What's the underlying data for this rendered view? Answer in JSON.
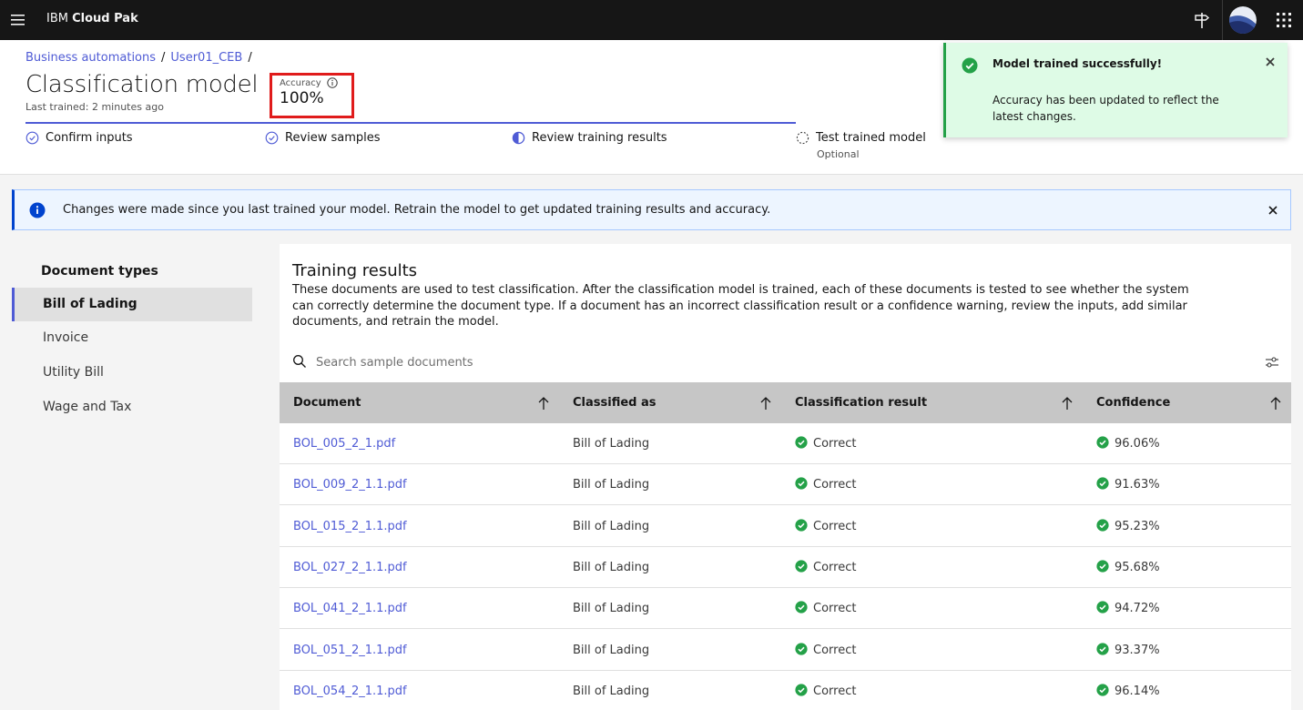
{
  "topbar": {
    "brand_prefix": "IBM",
    "brand_name": "Cloud Pak",
    "menu_icon": "hamburger-menu-icon",
    "signpost_icon": "signpost-icon",
    "apps_icon": "app-switcher-icon"
  },
  "breadcrumb": {
    "items": [
      "Business automations",
      "User01_CEB"
    ],
    "separator": "/"
  },
  "header": {
    "title": "Classification model",
    "last_trained": "Last trained: 2 minutes ago",
    "accuracy_label": "Accuracy",
    "accuracy_value": "100%"
  },
  "steps": [
    {
      "label": "Confirm inputs",
      "status": "complete"
    },
    {
      "label": "Review samples",
      "status": "complete"
    },
    {
      "label": "Review training results",
      "status": "current"
    },
    {
      "label": "Test trained model",
      "status": "incomplete",
      "sublabel": "Optional"
    }
  ],
  "toast": {
    "title": "Model trained successfully!",
    "body": "Accuracy has been updated to reflect the latest changes."
  },
  "banner": {
    "text": "Changes were made since you last trained your model. Retrain the model to get updated training results and accuracy."
  },
  "sidebar": {
    "heading": "Document types",
    "items": [
      {
        "label": "Bill of Lading",
        "active": true
      },
      {
        "label": "Invoice",
        "active": false
      },
      {
        "label": "Utility Bill",
        "active": false
      },
      {
        "label": "Wage and Tax",
        "active": false
      }
    ]
  },
  "main": {
    "title": "Training results",
    "description": "These documents are used to test classification. After the classification model is trained, each of these documents is tested to see whether the system can correctly determine the document type. If a document has an incorrect classification result or a confidence warning, review the inputs, add similar documents, and retrain the model.",
    "search_placeholder": "Search sample documents",
    "columns": [
      "Document",
      "Classified as",
      "Classification result",
      "Confidence"
    ],
    "rows": [
      {
        "document": "BOL_005_2_1.pdf",
        "classified_as": "Bill of Lading",
        "result": "Correct",
        "confidence": "96.06%"
      },
      {
        "document": "BOL_009_2_1.1.pdf",
        "classified_as": "Bill of Lading",
        "result": "Correct",
        "confidence": "91.63%"
      },
      {
        "document": "BOL_015_2_1.1.pdf",
        "classified_as": "Bill of Lading",
        "result": "Correct",
        "confidence": "95.23%"
      },
      {
        "document": "BOL_027_2_1.1.pdf",
        "classified_as": "Bill of Lading",
        "result": "Correct",
        "confidence": "95.68%"
      },
      {
        "document": "BOL_041_2_1.1.pdf",
        "classified_as": "Bill of Lading",
        "result": "Correct",
        "confidence": "94.72%"
      },
      {
        "document": "BOL_051_2_1.1.pdf",
        "classified_as": "Bill of Lading",
        "result": "Correct",
        "confidence": "93.37%"
      },
      {
        "document": "BOL_054_2_1.1.pdf",
        "classified_as": "Bill of Lading",
        "result": "Correct",
        "confidence": "96.14%"
      }
    ]
  },
  "colors": {
    "accent": "#4f5bd5",
    "success": "#24a148",
    "info": "#0043ce",
    "highlight_border": "#e01b1b"
  }
}
